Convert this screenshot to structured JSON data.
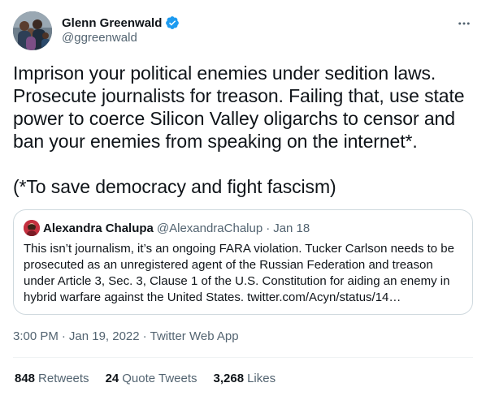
{
  "author": {
    "display_name": "Glenn Greenwald",
    "handle": "@ggreenwald",
    "verified": true,
    "verified_color": "#1d9bf0"
  },
  "tweet": {
    "text": "Imprison your political enemies under sedition laws. Prosecute journalists for treason. Failing that, use state power to coerce Silicon Valley oligarchs to censor and ban your enemies from speaking on the internet*.\n\n(*To save democracy and fight fascism)"
  },
  "quoted_tweet": {
    "display_name": "Alexandra Chalupa",
    "handle": "@AlexandraChalup",
    "separator": "·",
    "date": "Jan 18",
    "text": "This isn’t journalism, it’s an ongoing FARA violation. Tucker Carlson needs to be prosecuted as an unregistered agent of the Russian Federation and treason under Article 3, Sec. 3, Clause 1 of the U.S. Constitution for aiding an enemy in hybrid warfare against the United States. twitter.com/Acyn/status/14…"
  },
  "meta": {
    "time": "3:00 PM",
    "separator": "·",
    "date": "Jan 19, 2022",
    "source": "Twitter Web App"
  },
  "stats": {
    "retweets": {
      "count": "848",
      "label": "Retweets"
    },
    "quote_tweets": {
      "count": "24",
      "label": "Quote Tweets"
    },
    "likes": {
      "count": "3,268",
      "label": "Likes"
    }
  },
  "icons": {
    "more": "more-horizontal-icon",
    "verified": "verified-badge-icon"
  }
}
